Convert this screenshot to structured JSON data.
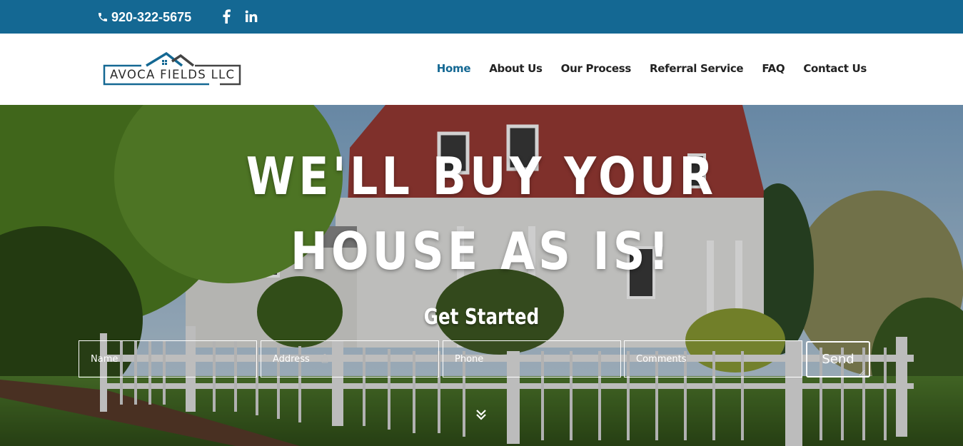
{
  "topbar": {
    "phone": "920-322-5675",
    "phone_icon": "phone-icon",
    "social": [
      "facebook-icon",
      "linkedin-icon"
    ],
    "bg_color": "#146893"
  },
  "header": {
    "logo_text": "AVOCA FIELDS LLC",
    "nav": [
      {
        "label": "Home",
        "active": true
      },
      {
        "label": "About Us"
      },
      {
        "label": "Our Process"
      },
      {
        "label": "Referral Service"
      },
      {
        "label": "FAQ"
      },
      {
        "label": "Contact Us"
      }
    ],
    "active_color": "#146893"
  },
  "hero": {
    "headline_line1": "WE'LL BUY YOUR",
    "headline_line2": "HOUSE AS IS!",
    "subhead": "Get Started",
    "form": {
      "name_placeholder": "Name",
      "address_placeholder": "Address",
      "phone_placeholder": "Phone",
      "comments_placeholder": "Comments",
      "send_label": "Send"
    },
    "scroll_icon": "double-chevron-down-icon"
  }
}
